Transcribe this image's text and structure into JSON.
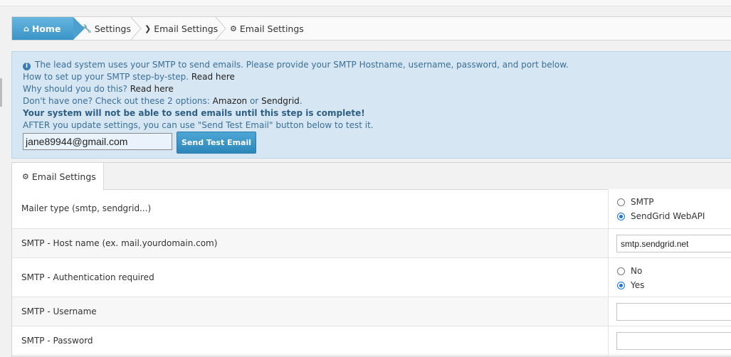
{
  "breadcrumb": {
    "home": "Home",
    "settings": "Settings",
    "email_settings_1": "Email Settings",
    "email_settings_2": "Email Settings"
  },
  "alert": {
    "line1": "The lead system uses your SMTP to send emails. Please provide your SMTP Hostname, username, password, and port below.",
    "line2_text": "How to set up your SMTP step-by-step.",
    "line2_link": "Read here",
    "line3_text": "Why should you do this?",
    "line3_link": "Read here",
    "line4_text": "Don't have one? Check out these 2 options:",
    "line4_link1": "Amazon",
    "line4_or": "or",
    "line4_link2": "Sendgrid",
    "line4_end": ".",
    "line5": "Your system will not be able to send emails until this step is complete!",
    "line6": "AFTER you update settings, you can use \"Send Test Email\" button below to test it.",
    "email_value": "jane89944@gmail.com",
    "test_button": "Send Test Email"
  },
  "panel": {
    "tab_label": "Email Settings",
    "rows": [
      {
        "label": "Mailer type (smtp, sendgrid...)",
        "options": [
          "SMTP",
          "SendGrid WebAPI"
        ],
        "selected": "SendGrid WebAPI"
      },
      {
        "label": "SMTP - Host name (ex. mail.yourdomain.com)",
        "value": "smtp.sendgrid.net"
      },
      {
        "label": "SMTP - Authentication required",
        "options": [
          "No",
          "Yes"
        ],
        "selected": "Yes"
      },
      {
        "label": "SMTP - Username",
        "value": ""
      },
      {
        "label": "SMTP - Password",
        "value": ""
      }
    ]
  },
  "colors": {
    "accent": "#3a94c7",
    "alert_bg": "#d6e6f2",
    "alert_text": "#3a6f99",
    "radio_on": "#1a73e8"
  }
}
